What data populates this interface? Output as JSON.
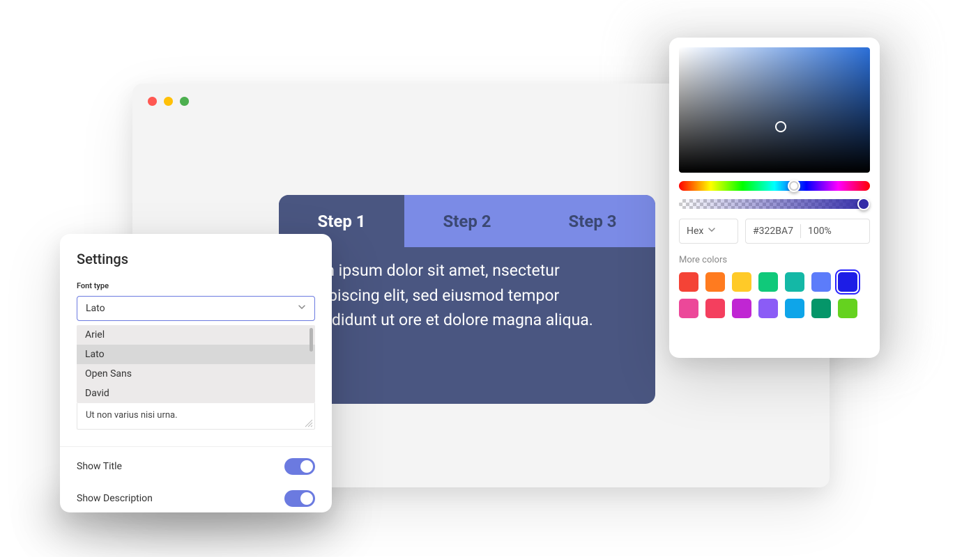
{
  "steps": {
    "tabs": [
      {
        "label": "Step 1",
        "active": true
      },
      {
        "label": "Step 2",
        "active": false
      },
      {
        "label": "Step 3",
        "active": false
      }
    ],
    "body": "rem ipsum dolor sit amet, nsectetur adipiscing elit, sed eiusmod tempor incididunt ut ore et dolore magna aliqua."
  },
  "settings": {
    "title": "Settings",
    "font_type_label": "Font type",
    "font_selected": "Lato",
    "font_options": [
      "Ariel",
      "Lato",
      "Open Sans",
      "David"
    ],
    "description_value": "Ut non varius nisi urna.",
    "show_title_label": "Show Title",
    "show_title_value": true,
    "show_description_label": "Show Description",
    "show_description_value": true
  },
  "color_picker": {
    "format_label": "Hex",
    "hex_value": "#322BA7",
    "alpha_value": "100%",
    "more_colors_label": "More colors",
    "swatches": [
      {
        "color": "#f44336",
        "selected": false
      },
      {
        "color": "#ff7b1f",
        "selected": false
      },
      {
        "color": "#ffca28",
        "selected": false
      },
      {
        "color": "#10c97a",
        "selected": false
      },
      {
        "color": "#14b8a6",
        "selected": false
      },
      {
        "color": "#5c7cfa",
        "selected": false
      },
      {
        "color": "#1d1de6",
        "selected": true
      },
      {
        "color": "#ec4899",
        "selected": false
      },
      {
        "color": "#f43f5e",
        "selected": false
      },
      {
        "color": "#c026d3",
        "selected": false
      },
      {
        "color": "#8b5cf6",
        "selected": false
      },
      {
        "color": "#0ea5e9",
        "selected": false
      },
      {
        "color": "#059669",
        "selected": false
      },
      {
        "color": "#65d21f",
        "selected": false
      }
    ]
  }
}
